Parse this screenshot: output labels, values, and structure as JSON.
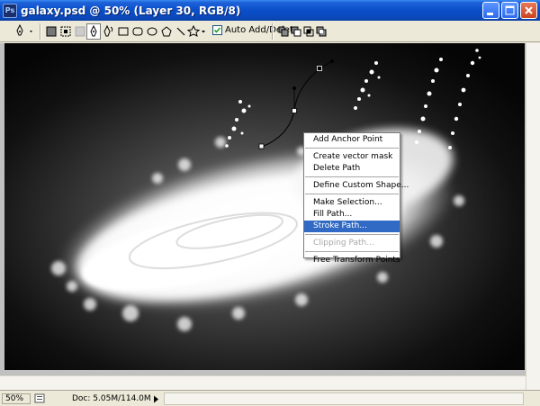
{
  "window": {
    "title": "galaxy.psd @ 50% (Layer 30, RGB/8)",
    "app_icon_text": "Ps"
  },
  "options_bar": {
    "tools": [
      "pen-tool-icon",
      "rectangle-shape-icon",
      "rounded-rectangle-icon",
      "ellipse-icon",
      "polygon-icon",
      "line-icon",
      "custom-shape-icon"
    ],
    "auto_add_delete_label": "Auto Add/Delete",
    "auto_add_delete_checked": true
  },
  "context_menu": {
    "items": [
      {
        "label": "Add Anchor Point",
        "state": "normal"
      },
      {
        "label": "Create vector mask",
        "state": "normal"
      },
      {
        "label": "Delete Path",
        "state": "normal"
      },
      {
        "label": "Define Custom Shape...",
        "state": "normal"
      },
      {
        "label": "Make Selection...",
        "state": "normal"
      },
      {
        "label": "Fill Path...",
        "state": "normal"
      },
      {
        "label": "Stroke Path...",
        "state": "highlighted"
      },
      {
        "label": "Clipping Path...",
        "state": "disabled"
      },
      {
        "label": "Free Transform Points",
        "state": "normal"
      }
    ]
  },
  "status_bar": {
    "zoom": "50%",
    "doc_info": "Doc: 5.05M/114.0M"
  },
  "colors": {
    "title_blue": "#0a4fc9",
    "menu_highlight": "#316ac5"
  }
}
